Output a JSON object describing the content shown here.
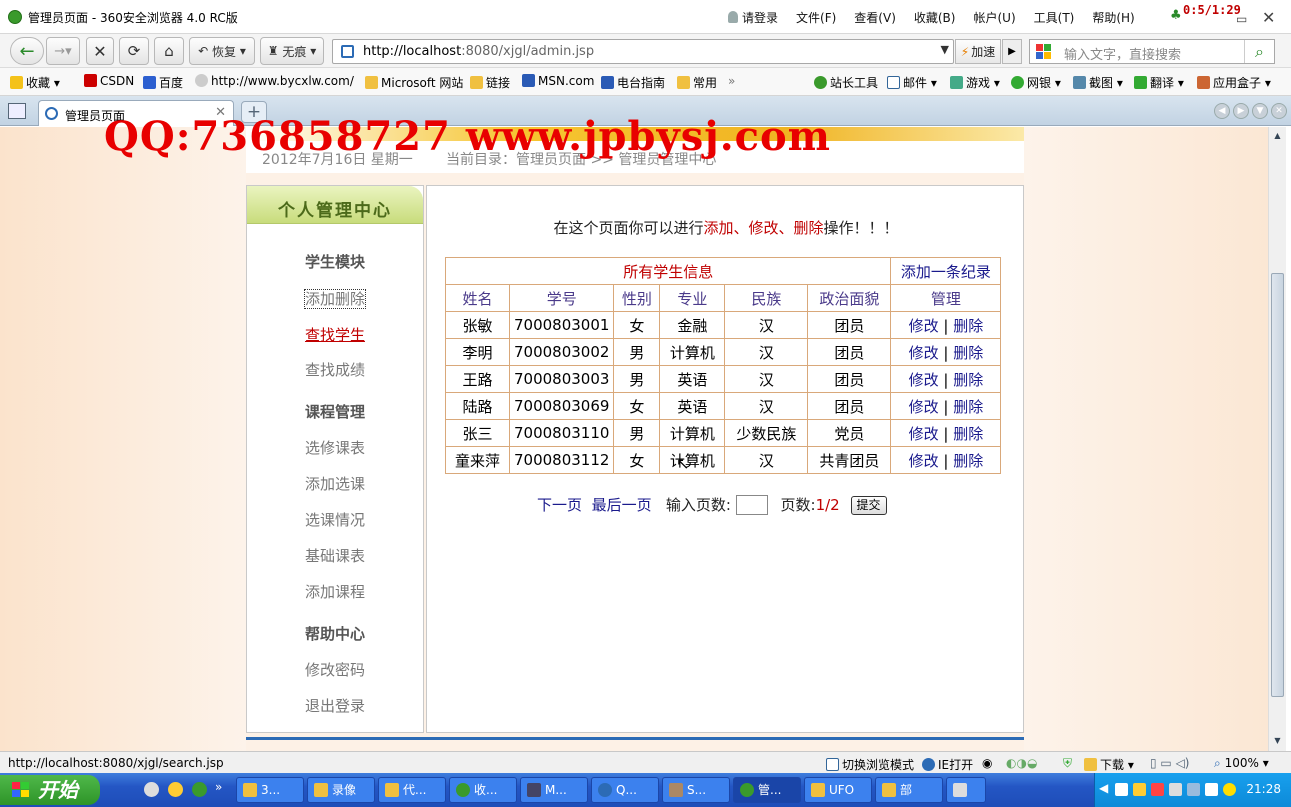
{
  "window": {
    "title": "管理员页面 - 360安全浏览器 4.0 RC版",
    "timer": "0:5/1:29",
    "menu": [
      "请登录",
      "文件(F)",
      "查看(V)",
      "收藏(B)",
      "帐户(U)",
      "工具(T)",
      "帮助(H)"
    ]
  },
  "toolbar": {
    "restore": "恢复",
    "noTrace": "无痕",
    "url_host": "http://localhost",
    "url_rest": ":8080/xjgl/admin.jsp",
    "speedup": "加速",
    "search_placeholder": "输入文字，直接搜索"
  },
  "bookmarks": {
    "left": [
      "收藏",
      "CSDN",
      "百度",
      "http://www.bycxlw.com/",
      "Microsoft 网站",
      "链接",
      "MSN.com",
      "电台指南",
      "常用",
      "»"
    ],
    "right": [
      "站长工具",
      "邮件",
      "游戏",
      "网银",
      "截图",
      "翻译",
      "应用盒子"
    ]
  },
  "tab": {
    "label": "管理员页面"
  },
  "watermark": "QQ:736858727 www.jpbysj.com",
  "page": {
    "date": "2012年7月16日 星期一",
    "breadcrumb": "当前目录：管理员页面 >> 管理员管理中心",
    "sidebar": {
      "header": "个人管理中心",
      "sections": [
        {
          "title": "学生模块",
          "links": [
            "添加删除",
            "查找学生",
            "查找成绩"
          ]
        },
        {
          "title": "课程管理",
          "links": [
            "选修课表",
            "添加选课",
            "选课情况",
            "基础课表",
            "添加课程"
          ]
        },
        {
          "title": "帮助中心",
          "links": [
            "修改密码",
            "退出登录"
          ]
        }
      ]
    },
    "intro": {
      "before": "在这个页面你可以进行",
      "highlight": "添加、修改、删除",
      "after": "操作！！！"
    },
    "table": {
      "caption": "所有学生信息",
      "add_link": "添加一条纪录",
      "headers": [
        "姓名",
        "学号",
        "性别",
        "专业",
        "民族",
        "政治面貌",
        "管理"
      ],
      "rows": [
        {
          "name": "张敏",
          "id": "7000803001",
          "sex": "女",
          "major": "金融",
          "ethnic": "汉",
          "political": "团员"
        },
        {
          "name": "李明",
          "id": "7000803002",
          "sex": "男",
          "major": "计算机",
          "ethnic": "汉",
          "political": "团员"
        },
        {
          "name": "王路",
          "id": "7000803003",
          "sex": "男",
          "major": "英语",
          "ethnic": "汉",
          "political": "团员"
        },
        {
          "name": "陆路",
          "id": "7000803069",
          "sex": "女",
          "major": "英语",
          "ethnic": "汉",
          "political": "团员"
        },
        {
          "name": "张三",
          "id": "7000803110",
          "sex": "男",
          "major": "计算机",
          "ethnic": "少数民族",
          "political": "党员"
        },
        {
          "name": "童来萍",
          "id": "7000803112",
          "sex": "女",
          "major": "计算机",
          "ethnic": "汉",
          "political": "共青团员"
        }
      ],
      "edit": "修改",
      "sep": "|",
      "delete": "删除"
    },
    "pager": {
      "next": "下一页",
      "last": "最后一页",
      "input_label": "输入页数:",
      "pages_label": "页数:",
      "pages_value": "1/2",
      "submit": "提交"
    }
  },
  "status": {
    "url": "http://localhost:8080/xjgl/search.jsp",
    "mode": "切换浏览模式",
    "ie": "IE打开",
    "download": "下载",
    "zoom": "100%"
  },
  "taskbar": {
    "start": "开始",
    "tasks": [
      "3...",
      "录像",
      "代...",
      "收...",
      "M...",
      "Q...",
      "S...",
      "管...",
      "UFO",
      "部"
    ],
    "clock": "21:28"
  }
}
